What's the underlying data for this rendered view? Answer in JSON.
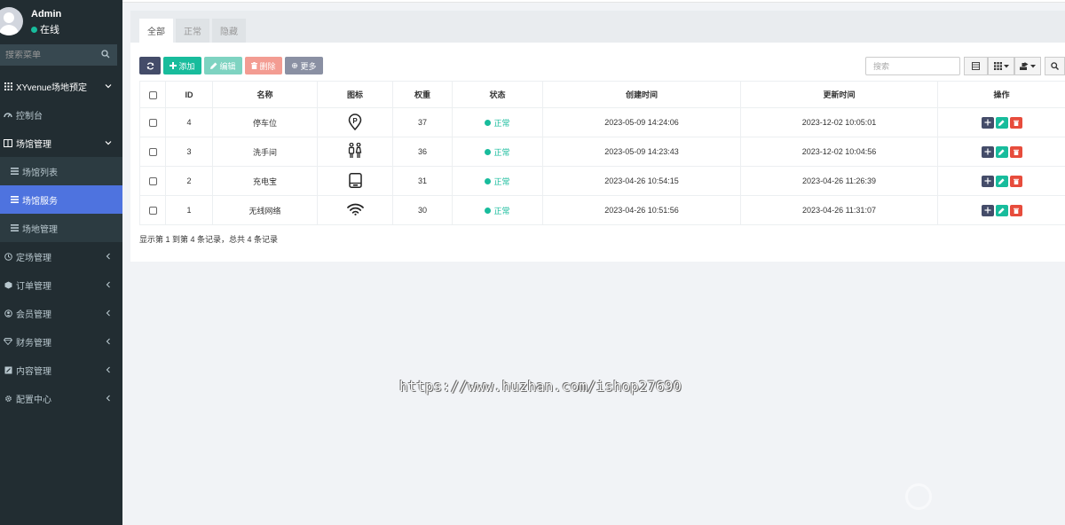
{
  "user": {
    "name": "Admin",
    "status": "在线"
  },
  "sidebar": {
    "search_placeholder": "搜索菜单",
    "items": [
      {
        "label": "XYvenue场地预定",
        "icon": "grid-icon",
        "type": "header"
      },
      {
        "label": "控制台",
        "icon": "dashboard-icon",
        "type": "item"
      },
      {
        "label": "场馆管理",
        "icon": "columns-icon",
        "type": "header"
      },
      {
        "label": "场馆列表",
        "icon": "list-icon",
        "type": "sub"
      },
      {
        "label": "场馆服务",
        "icon": "list-icon",
        "type": "sub",
        "active": true
      },
      {
        "label": "场地管理",
        "icon": "list-icon",
        "type": "sub"
      },
      {
        "label": "定场管理",
        "icon": "clock-icon",
        "type": "item"
      },
      {
        "label": "订单管理",
        "icon": "cube-icon",
        "type": "item"
      },
      {
        "label": "会员管理",
        "icon": "user-circle-icon",
        "type": "item"
      },
      {
        "label": "财务管理",
        "icon": "diamond-icon",
        "type": "item"
      },
      {
        "label": "内容管理",
        "icon": "edit-square-icon",
        "type": "item"
      },
      {
        "label": "配置中心",
        "icon": "gear-icon",
        "type": "item"
      }
    ]
  },
  "tabs": [
    "全部",
    "正常",
    "隐藏"
  ],
  "toolbar": {
    "add_label": "添加",
    "edit_label": "编辑",
    "delete_label": "删除",
    "more_label": "更多",
    "search_placeholder": "搜索"
  },
  "table": {
    "columns": [
      "ID",
      "名称",
      "图标",
      "权重",
      "状态",
      "创建时间",
      "更新时间",
      "操作"
    ],
    "rows": [
      {
        "id": "4",
        "name": "停车位",
        "icon": "parking-icon",
        "weight": "37",
        "status": "正常",
        "created": "2023-05-09 14:24:06",
        "updated": "2023-12-02 10:05:01"
      },
      {
        "id": "3",
        "name": "洗手间",
        "icon": "restroom-icon",
        "weight": "36",
        "status": "正常",
        "created": "2023-05-09 14:23:43",
        "updated": "2023-12-02 10:04:56"
      },
      {
        "id": "2",
        "name": "充电宝",
        "icon": "power-bank-icon",
        "weight": "31",
        "status": "正常",
        "created": "2023-04-26 10:54:15",
        "updated": "2023-04-26 11:26:39"
      },
      {
        "id": "1",
        "name": "无线网络",
        "icon": "wifi-icon",
        "weight": "30",
        "status": "正常",
        "created": "2023-04-26 10:51:56",
        "updated": "2023-04-26 11:31:07"
      }
    ]
  },
  "summary": "显示第 1 到第 4 条记录，总共 4 条记录",
  "watermark": "https://www.huzhan.com/ishop27690",
  "colors": {
    "sidebar_bg": "#222d32",
    "active": "#4e73df",
    "success": "#18bc9c",
    "danger": "#e74c3c",
    "primary_dark": "#444c69"
  }
}
